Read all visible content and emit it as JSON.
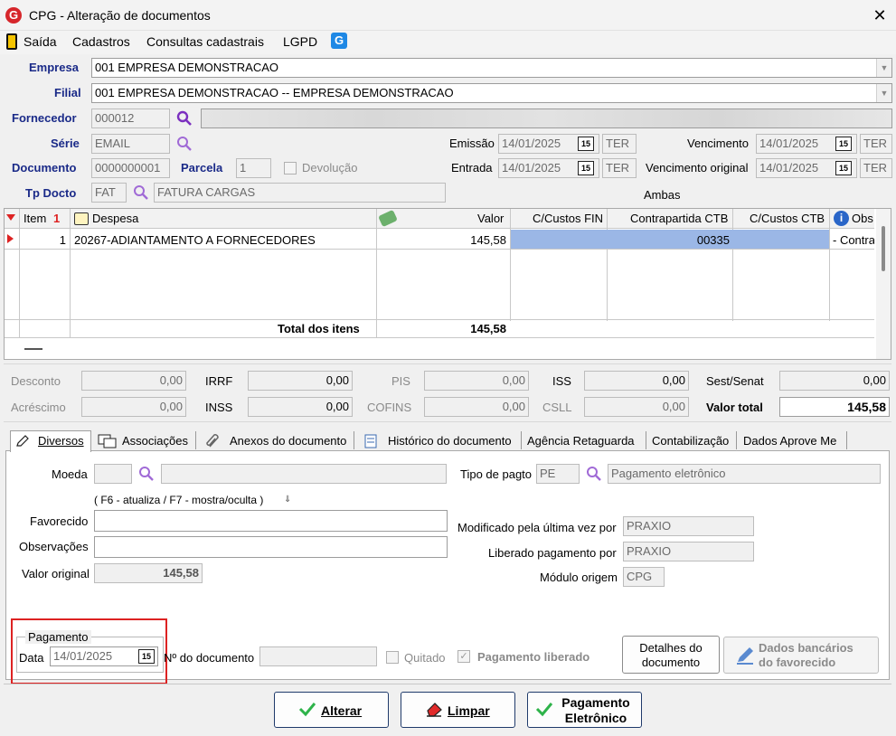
{
  "window": {
    "title": "CPG - Alteração de documentos",
    "close": "✕",
    "app_icon": "G"
  },
  "menu": {
    "items": [
      "Saída",
      "Cadastros",
      "Consultas cadastrais",
      "LGPD"
    ],
    "g_icon": "G"
  },
  "header": {
    "empresa_label": "Empresa",
    "empresa_value": "001 EMPRESA DEMONSTRACAO",
    "filial_label": "Filial",
    "filial_value": "001 EMPRESA DEMONSTRACAO -- EMPRESA DEMONSTRACAO",
    "fornecedor_label": "Fornecedor",
    "fornecedor_value": "000012",
    "serie_label": "Série",
    "serie_value": "EMAIL",
    "documento_label": "Documento",
    "documento_value": "0000000001",
    "parcela_label": "Parcela",
    "parcela_value": "1",
    "devolucao_label": "Devolução",
    "tpdocto_label": "Tp Docto",
    "tpdocto_code": "FAT",
    "tpdocto_desc": "FATURA CARGAS",
    "emissao_label": "Emissão",
    "emissao_value": "14/01/2025",
    "emissao_day": "TER",
    "entrada_label": "Entrada",
    "entrada_value": "14/01/2025",
    "entrada_day": "TER",
    "vencimento_label": "Vencimento",
    "vencimento_value": "14/01/2025",
    "vencimento_day": "TER",
    "venc_orig_label": "Vencimento original",
    "venc_orig_value": "14/01/2025",
    "venc_orig_day": "TER",
    "ambas": "Ambas",
    "cal_glyph": "15"
  },
  "grid": {
    "columns": {
      "item": "Item",
      "item_sort": "1",
      "despesa": "Despesa",
      "valor": "Valor",
      "ccfin": "C/Custos FIN",
      "contrapartida": "Contrapartida CTB",
      "ccctb": "C/Custos CTB",
      "obs": "Obs"
    },
    "rows": [
      {
        "item": "1",
        "despesa": "20267-ADIANTAMENTO A FORNECEDORES",
        "valor": "145,58",
        "ccfin": "",
        "contrapartida": "00335",
        "ccctb": "",
        "obs": "- Contra"
      }
    ],
    "total_label": "Total dos itens",
    "total_value": "145,58"
  },
  "totals": {
    "desconto_label": "Desconto",
    "desconto": "0,00",
    "acrescimo_label": "Acréscimo",
    "acrescimo": "0,00",
    "irrf_label": "IRRF",
    "irrf": "0,00",
    "inss_label": "INSS",
    "inss": "0,00",
    "pis_label": "PIS",
    "pis": "0,00",
    "cofins_label": "COFINS",
    "cofins": "0,00",
    "iss_label": "ISS",
    "iss": "0,00",
    "csll_label": "CSLL",
    "csll": "0,00",
    "sest_label": "Sest/Senat",
    "sest": "0,00",
    "valor_total_label": "Valor total",
    "valor_total": "145,58"
  },
  "tabs": [
    "Diversos",
    "Associações",
    "Anexos do documento",
    "Histórico do documento",
    "Agência Retaguarda",
    "Contabilização",
    "Dados Aprove Me"
  ],
  "diversos": {
    "moeda_label": "Moeda",
    "moeda_value": "",
    "hint": "( F6 - atualiza / F7 - mostra/oculta )",
    "favorecido_label": "Favorecido",
    "favorecido_value": "",
    "observacoes_label": "Observações",
    "observacoes_value": "",
    "valor_original_label": "Valor original",
    "valor_original": "145,58",
    "tipo_pagto_label": "Tipo de pagto",
    "tipo_pagto_code": "PE",
    "tipo_pagto_desc": "Pagamento eletrônico",
    "modificado_label": "Modificado pela última vez por",
    "modificado_value": "PRAXIO",
    "liberado_label": "Liberado pagamento por",
    "liberado_value": "PRAXIO",
    "modulo_label": "Módulo origem",
    "modulo_value": "CPG",
    "pagamento_group": "Pagamento",
    "data_label": "Data",
    "data_value": "14/01/2025",
    "ndoc_label": "Nº do documento",
    "ndoc_value": "",
    "quitado_label": "Quitado",
    "pag_liberado_label": "Pagamento liberado",
    "detalhes_btn": [
      "Detalhes do",
      "documento"
    ],
    "dados_bancarios_btn": [
      "Dados bancários",
      "do favorecido"
    ]
  },
  "footer": {
    "alterar": "Alterar",
    "limpar": "Limpar",
    "pag_eletronico": [
      "Pagamento",
      "Eletrônico"
    ]
  },
  "colors": {
    "title_blue": "#1a2a88",
    "selection": "#9bb7e6",
    "highlight": "#d22222"
  }
}
